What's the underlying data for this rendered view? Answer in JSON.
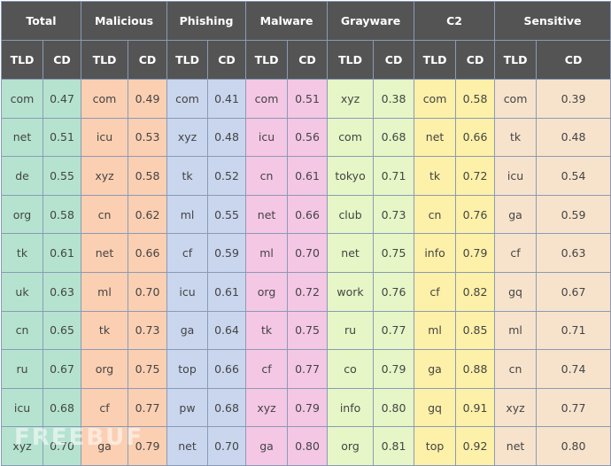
{
  "groups": [
    "Total",
    "Malicious",
    "Phishing",
    "Malware",
    "Grayware",
    "C2",
    "Sensitive"
  ],
  "sub_headers": [
    "TLD",
    "CD"
  ],
  "colors": [
    "#b5e3d0",
    "#fbcfb2",
    "#c9d6ee",
    "#f4c7e5",
    "#e6f6c6",
    "#fdf0a8",
    "#f7e3cc"
  ],
  "rows": [
    [
      "com",
      "0.47",
      "com",
      "0.49",
      "com",
      "0.41",
      "com",
      "0.51",
      "xyz",
      "0.38",
      "com",
      "0.58",
      "com",
      "0.39"
    ],
    [
      "net",
      "0.51",
      "icu",
      "0.53",
      "xyz",
      "0.48",
      "icu",
      "0.56",
      "com",
      "0.68",
      "net",
      "0.66",
      "tk",
      "0.48"
    ],
    [
      "de",
      "0.55",
      "xyz",
      "0.58",
      "tk",
      "0.52",
      "cn",
      "0.61",
      "tokyo",
      "0.71",
      "tk",
      "0.72",
      "icu",
      "0.54"
    ],
    [
      "org",
      "0.58",
      "cn",
      "0.62",
      "ml",
      "0.55",
      "net",
      "0.66",
      "club",
      "0.73",
      "cn",
      "0.76",
      "ga",
      "0.59"
    ],
    [
      "tk",
      "0.61",
      "net",
      "0.66",
      "cf",
      "0.59",
      "ml",
      "0.70",
      "net",
      "0.75",
      "info",
      "0.79",
      "cf",
      "0.63"
    ],
    [
      "uk",
      "0.63",
      "ml",
      "0.70",
      "icu",
      "0.61",
      "org",
      "0.72",
      "work",
      "0.76",
      "cf",
      "0.82",
      "gq",
      "0.67"
    ],
    [
      "cn",
      "0.65",
      "tk",
      "0.73",
      "ga",
      "0.64",
      "tk",
      "0.75",
      "ru",
      "0.77",
      "ml",
      "0.85",
      "ml",
      "0.71"
    ],
    [
      "ru",
      "0.67",
      "org",
      "0.75",
      "top",
      "0.66",
      "cf",
      "0.77",
      "co",
      "0.79",
      "ga",
      "0.88",
      "cn",
      "0.74"
    ],
    [
      "icu",
      "0.68",
      "cf",
      "0.77",
      "pw",
      "0.68",
      "xyz",
      "0.79",
      "info",
      "0.80",
      "gq",
      "0.91",
      "xyz",
      "0.77"
    ],
    [
      "xyz",
      "0.70",
      "ga",
      "0.79",
      "net",
      "0.70",
      "ga",
      "0.80",
      "org",
      "0.81",
      "top",
      "0.92",
      "net",
      "0.80"
    ]
  ],
  "watermark": "FREEBUF"
}
